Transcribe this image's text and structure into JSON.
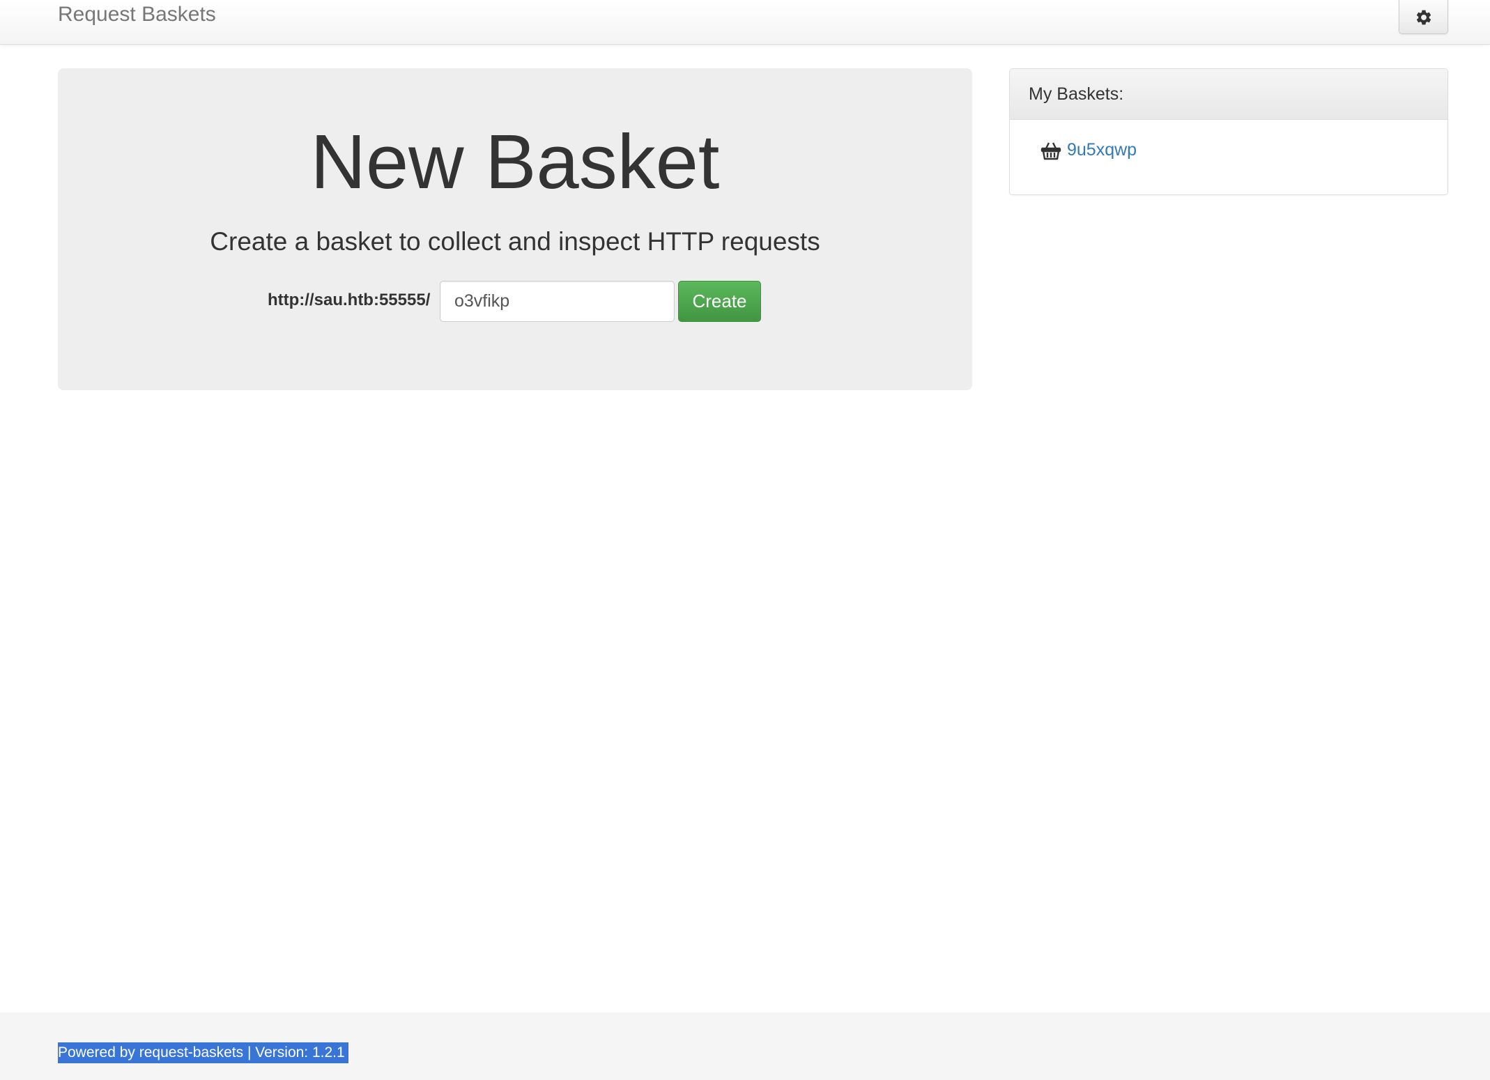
{
  "navbar": {
    "brand": "Request Baskets",
    "settings_icon": "gear-icon"
  },
  "jumbotron": {
    "title": "New Basket",
    "subtitle": "Create a basket to collect and inspect HTTP requests",
    "url_prefix": "http://sau.htb:55555/",
    "basket_name_value": "o3vfikp",
    "create_label": "Create"
  },
  "my_baskets": {
    "heading": "My Baskets:",
    "items": [
      {
        "icon": "basket-icon",
        "name": "9u5xqwp"
      }
    ],
    "link_color": "#337ab7"
  },
  "footer": {
    "text": "Powered by request-baskets | Version: 1.2.1"
  },
  "colors": {
    "create_button": "#5cb85c",
    "selection_highlight": "#3875d7"
  }
}
